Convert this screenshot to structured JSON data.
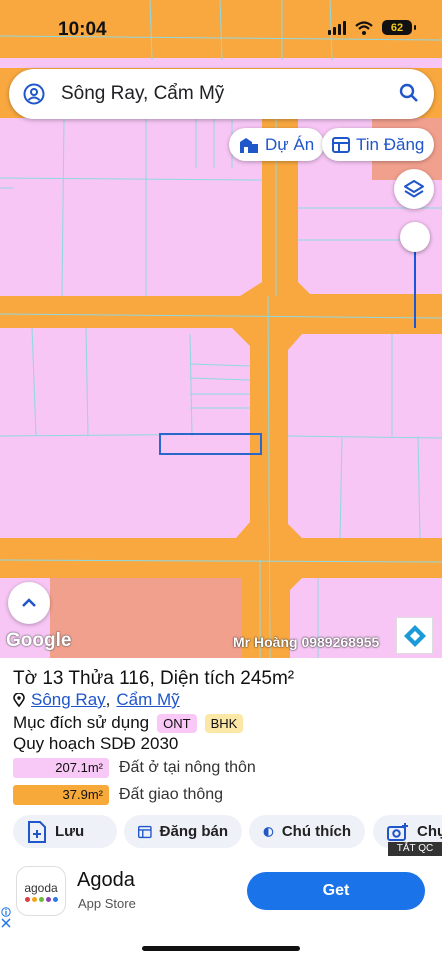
{
  "status_bar": {
    "time": "10:04",
    "battery": "62"
  },
  "search": {
    "value": "Sông Ray, Cẩm Mỹ"
  },
  "chips": {
    "projects": "Dự Án",
    "listings": "Tin Đăng"
  },
  "map": {
    "google_logo": "Google",
    "watermark": "Mr Hoàng 0989268955",
    "colors": {
      "residential": "#f7c6f5",
      "road": "#f9a83f",
      "building": "#f2a08e",
      "line": "#8fd8e2",
      "selection": "#2a66cc"
    }
  },
  "parcel": {
    "title": "Tờ 13 Thửa 116, Diện tích 245m²",
    "location_commune": "Sông Ray",
    "location_district": "Cẩm Mỹ",
    "comma": ",",
    "purpose_label": "Mục đích sử dụng",
    "tags": [
      "ONT",
      "BHK"
    ],
    "plan": "Quy hoạch SDĐ 2030",
    "areas": [
      {
        "value": "207.1m²",
        "label": "Đất ở tại nông thôn",
        "color": "#f8c8f6"
      },
      {
        "value": "37.9m²",
        "label": "Đất giao thông",
        "color": "#f7a93a"
      }
    ]
  },
  "actions": {
    "save": "Lưu",
    "sell": "Đăng bán",
    "note": "Chú thích",
    "photo": "Chụp"
  },
  "hide_ad": "TẮT QC",
  "ad": {
    "icon_text": "agoda",
    "name": "Agoda",
    "store": "App Store",
    "cta": "Get"
  }
}
